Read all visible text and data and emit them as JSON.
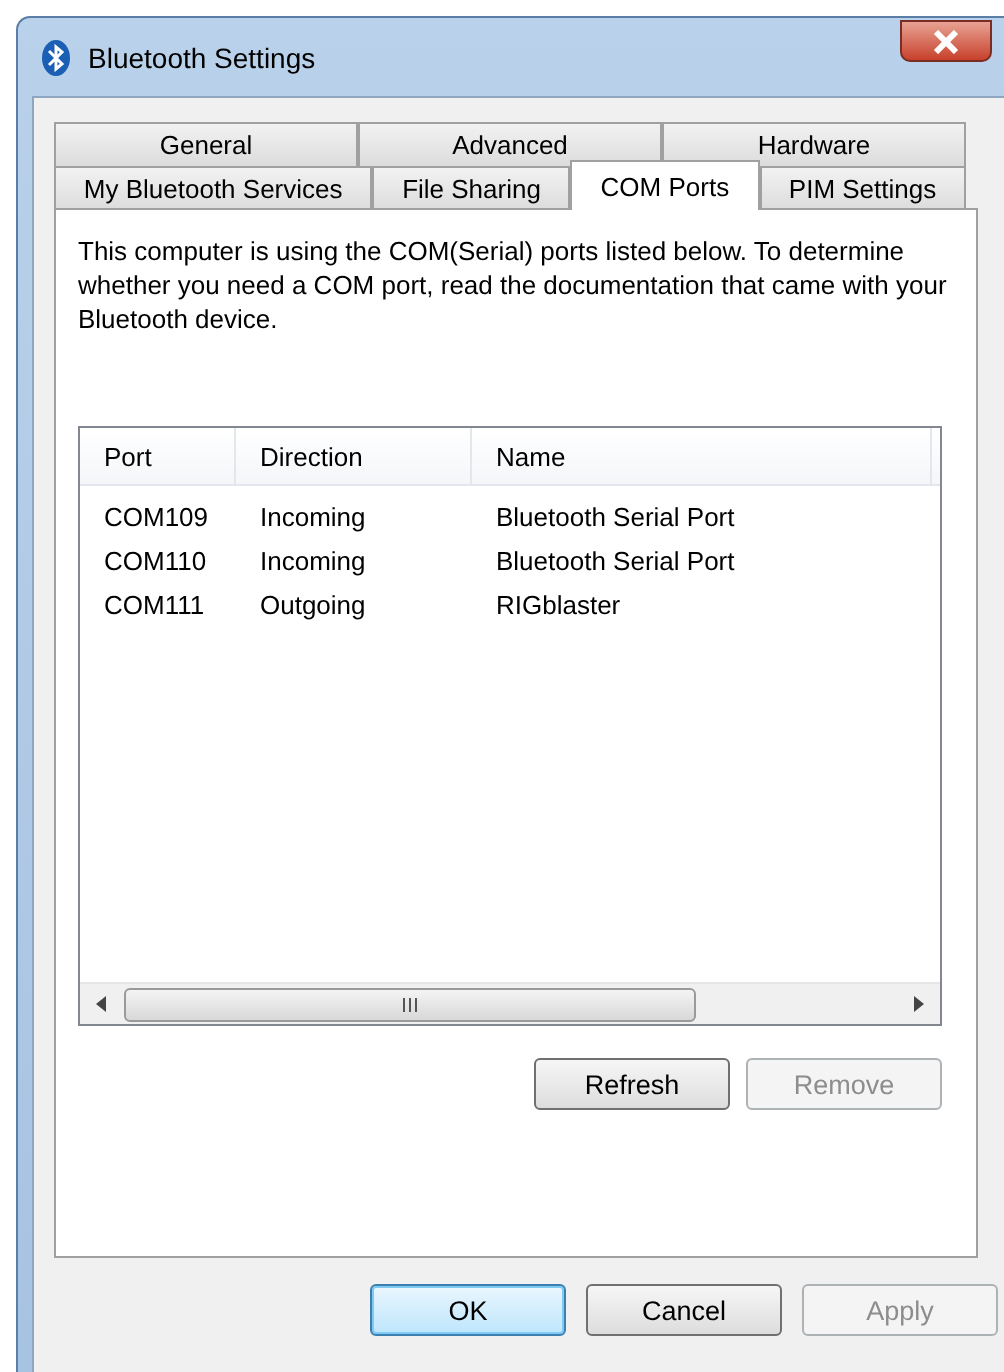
{
  "window": {
    "title": "Bluetooth Settings"
  },
  "tab_rows": [
    [
      {
        "label": "General",
        "selected": false
      },
      {
        "label": "Advanced",
        "selected": false
      },
      {
        "label": "Hardware",
        "selected": false
      }
    ],
    [
      {
        "label": "My Bluetooth Services",
        "selected": false
      },
      {
        "label": "File Sharing",
        "selected": false
      },
      {
        "label": "COM Ports",
        "selected": true
      },
      {
        "label": "PIM Settings",
        "selected": false
      }
    ]
  ],
  "description": "This computer is using the COM(Serial) ports listed below. To determine whether you need a COM port, read the documentation that came with your Bluetooth device.",
  "table": {
    "columns": [
      "Port",
      "Direction",
      "Name"
    ],
    "rows": [
      [
        "COM109",
        "Incoming",
        "Bluetooth Serial Port"
      ],
      [
        "COM110",
        "Incoming",
        "Bluetooth Serial Port"
      ],
      [
        "COM111",
        "Outgoing",
        "RIGblaster"
      ]
    ]
  },
  "panel_buttons": [
    {
      "label": "Refresh",
      "disabled": false
    },
    {
      "label": "Remove",
      "disabled": true
    }
  ],
  "dialog_buttons": [
    {
      "label": "OK",
      "disabled": false,
      "default": true
    },
    {
      "label": "Cancel",
      "disabled": false,
      "default": false
    },
    {
      "label": "Apply",
      "disabled": true,
      "default": false
    }
  ]
}
